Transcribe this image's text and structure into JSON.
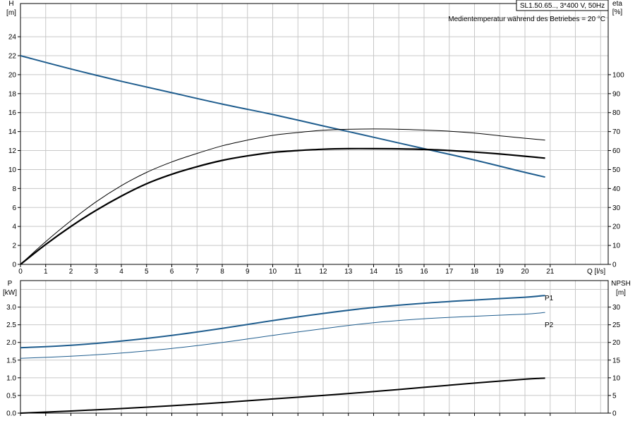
{
  "chart_data": [
    {
      "id": "head",
      "type": "line",
      "title_box": "SL1.50.65.., 3*400 V, 50Hz",
      "annotation": "Medientemperatur während des Betriebes = 20 °C",
      "xlabel": "Q [l/s]",
      "ylabel_top": "H",
      "ylabel_unit": "[m]",
      "y2label_top": "eta",
      "y2label_unit": "[%]",
      "xlim": [
        0,
        23.3
      ],
      "ylim": [
        0,
        27.5
      ],
      "y2lim": [
        0,
        137.5
      ],
      "x_ticks": [
        0,
        1,
        2,
        3,
        4,
        5,
        6,
        7,
        8,
        9,
        10,
        11,
        12,
        13,
        14,
        15,
        16,
        17,
        18,
        19,
        20,
        21
      ],
      "y_ticks": [
        0,
        2,
        4,
        6,
        8,
        10,
        12,
        14,
        16,
        18,
        20,
        22,
        24
      ],
      "y2_ticks": [
        0,
        10,
        20,
        30,
        40,
        50,
        60,
        70,
        80,
        90,
        100
      ],
      "grid": true,
      "series": [
        {
          "axis": "y",
          "color": "#1f5d8e",
          "width": 2,
          "points": [
            [
              0,
              22.0
            ],
            [
              2,
              20.6
            ],
            [
              4,
              19.3
            ],
            [
              6,
              18.1
            ],
            [
              8,
              16.9
            ],
            [
              10,
              15.8
            ],
            [
              12,
              14.6
            ],
            [
              14,
              13.4
            ],
            [
              16,
              12.2
            ],
            [
              18,
              11.0
            ],
            [
              20,
              9.7
            ],
            [
              20.8,
              9.2
            ]
          ]
        },
        {
          "axis": "y2",
          "color": "#000000",
          "width": 1,
          "points": [
            [
              0,
              0
            ],
            [
              1,
              12
            ],
            [
              2,
              23
            ],
            [
              3,
              33
            ],
            [
              4,
              41.5
            ],
            [
              5,
              48.5
            ],
            [
              6,
              54
            ],
            [
              7,
              58.5
            ],
            [
              8,
              62.5
            ],
            [
              9,
              65.5
            ],
            [
              10,
              68
            ],
            [
              11,
              69.5
            ],
            [
              12,
              70.7
            ],
            [
              13,
              71.2
            ],
            [
              14,
              71.4
            ],
            [
              15,
              71.2
            ],
            [
              16,
              70.8
            ],
            [
              17,
              70.2
            ],
            [
              18,
              69.2
            ],
            [
              19,
              67.8
            ],
            [
              20,
              66.5
            ],
            [
              20.8,
              65.5
            ]
          ]
        },
        {
          "axis": "y2",
          "color": "#000000",
          "width": 2.2,
          "points": [
            [
              0,
              0
            ],
            [
              1,
              10.5
            ],
            [
              2,
              20
            ],
            [
              3,
              28.5
            ],
            [
              4,
              36
            ],
            [
              5,
              42.5
            ],
            [
              6,
              47.5
            ],
            [
              7,
              51.5
            ],
            [
              8,
              54.8
            ],
            [
              9,
              57.2
            ],
            [
              10,
              59
            ],
            [
              11,
              60
            ],
            [
              12,
              60.7
            ],
            [
              13,
              61
            ],
            [
              14,
              61
            ],
            [
              15,
              60.9
            ],
            [
              16,
              60.6
            ],
            [
              17,
              60
            ],
            [
              18,
              59.2
            ],
            [
              19,
              58.2
            ],
            [
              20,
              57
            ],
            [
              20.8,
              56
            ]
          ]
        }
      ]
    },
    {
      "id": "power",
      "type": "line",
      "ylabel_top": "P",
      "ylabel_unit": "[kW]",
      "y2label_top": "NPSH",
      "y2label_unit": "[m]",
      "xlim": [
        0,
        23.3
      ],
      "ylim": [
        0,
        3.75
      ],
      "y2lim": [
        0,
        37.5
      ],
      "y_ticks": [
        0.0,
        0.5,
        1.0,
        1.5,
        2.0,
        2.5,
        3.0
      ],
      "y_tick_labels": [
        "0.0",
        "0.5",
        "1.0",
        "1.5",
        "2.0",
        "2.5",
        "3.0"
      ],
      "y2_ticks": [
        0,
        5,
        10,
        15,
        20,
        25,
        30
      ],
      "grid": true,
      "series": [
        {
          "name": "P1",
          "axis": "y",
          "color": "#1f5d8e",
          "width": 2,
          "points": [
            [
              0,
              1.85
            ],
            [
              2,
              1.92
            ],
            [
              4,
              2.04
            ],
            [
              6,
              2.2
            ],
            [
              8,
              2.4
            ],
            [
              10,
              2.62
            ],
            [
              12,
              2.82
            ],
            [
              14,
              2.99
            ],
            [
              16,
              3.11
            ],
            [
              18,
              3.2
            ],
            [
              20,
              3.28
            ],
            [
              20.8,
              3.33
            ]
          ]
        },
        {
          "name": "P2",
          "axis": "y",
          "color": "#1f5d8e",
          "width": 1,
          "points": [
            [
              0,
              1.55
            ],
            [
              2,
              1.61
            ],
            [
              4,
              1.7
            ],
            [
              6,
              1.83
            ],
            [
              8,
              2.0
            ],
            [
              10,
              2.2
            ],
            [
              12,
              2.39
            ],
            [
              14,
              2.56
            ],
            [
              16,
              2.67
            ],
            [
              18,
              2.74
            ],
            [
              20,
              2.8
            ],
            [
              20.8,
              2.85
            ]
          ]
        },
        {
          "axis": "y2",
          "color": "#000000",
          "width": 2,
          "points": [
            [
              0,
              0
            ],
            [
              2,
              0.6
            ],
            [
              4,
              1.3
            ],
            [
              6,
              2.1
            ],
            [
              8,
              3.0
            ],
            [
              10,
              4.0
            ],
            [
              12,
              5.0
            ],
            [
              14,
              6.1
            ],
            [
              16,
              7.3
            ],
            [
              18,
              8.5
            ],
            [
              20,
              9.6
            ],
            [
              20.8,
              9.9
            ]
          ]
        }
      ]
    }
  ]
}
